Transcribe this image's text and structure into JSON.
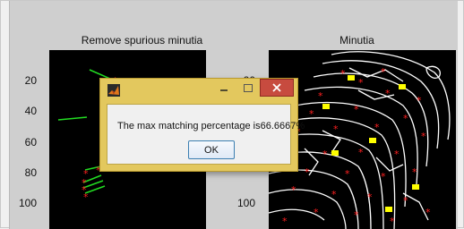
{
  "figure": {
    "left_axes": {
      "title": "Remove spurious minutia",
      "y_ticks": [
        "20",
        "40",
        "60",
        "80",
        "100",
        ""
      ]
    },
    "right_axes": {
      "title": "Minutia",
      "y_ticks": [
        "20",
        "",
        "",
        "",
        "100",
        ""
      ]
    },
    "colors": {
      "plot_bg": "#000000",
      "ridge": "#ffffff",
      "minutia_red": "#ff2020",
      "minutia_yellow": "#ffff00",
      "arrow_green": "#22dd22"
    }
  },
  "dialog": {
    "icon": "matlab-icon",
    "title": "",
    "message": "The max matching percentage is66.6667%",
    "ok_label": "OK",
    "title_buttons": [
      "minimize-icon",
      "maximize-icon",
      "close-icon"
    ]
  }
}
